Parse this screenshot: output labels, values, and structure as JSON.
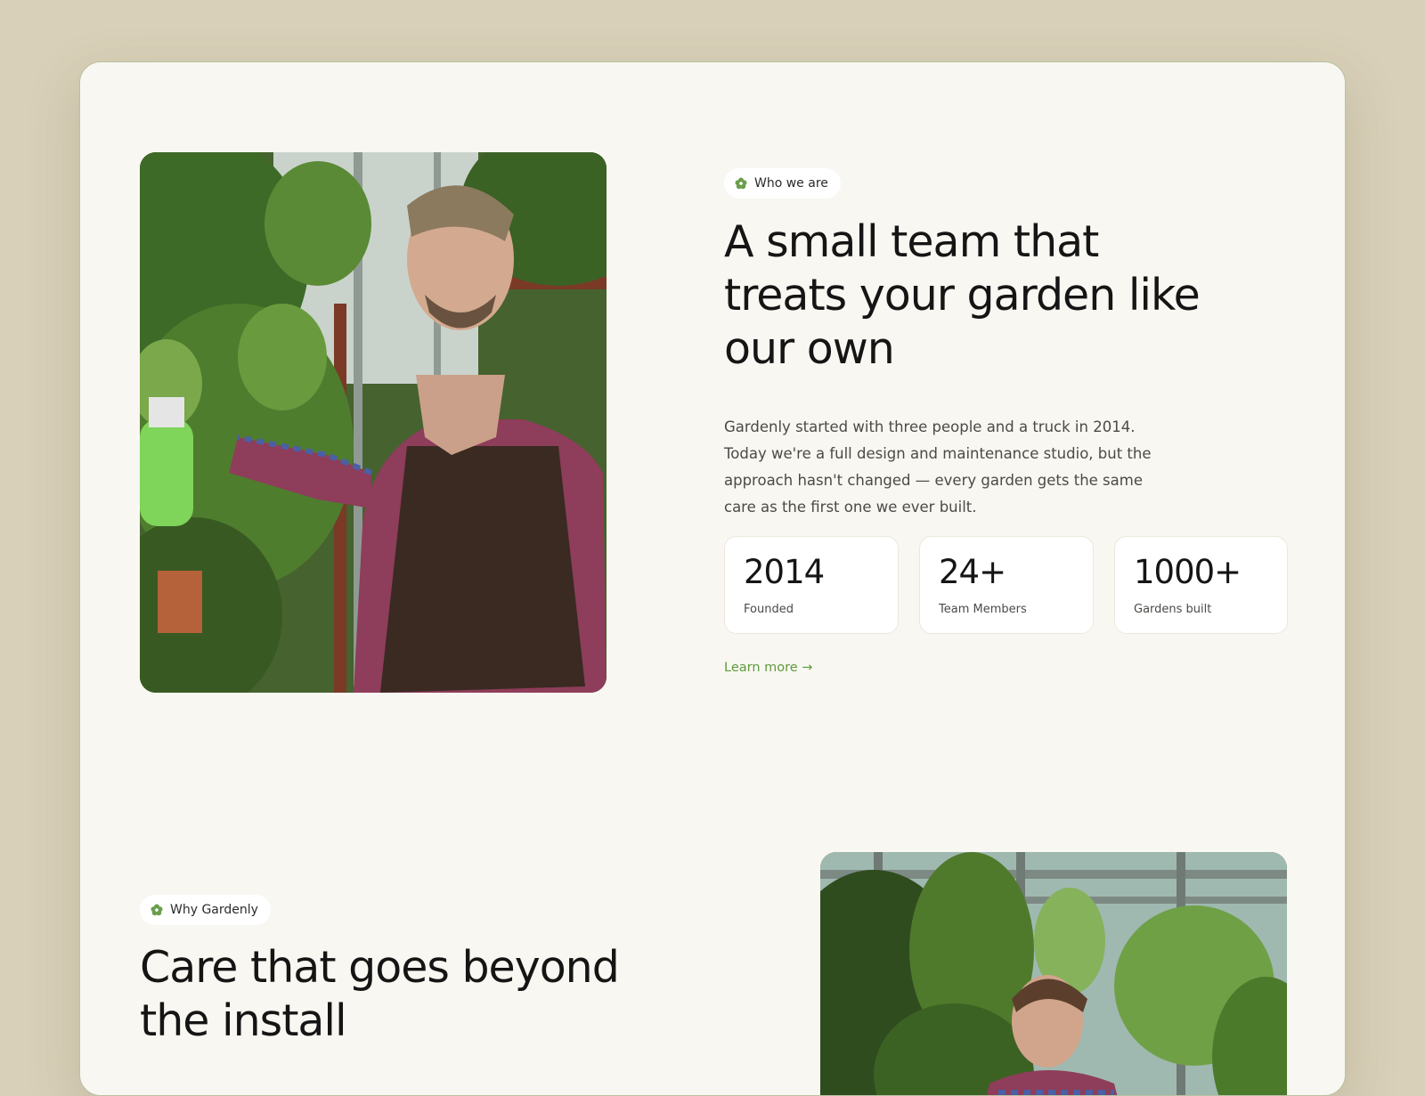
{
  "about": {
    "badge": "Who we are",
    "badge_icon": "flower-icon",
    "headline": "A small team that treats your garden like our own",
    "body": "Gardenly started with three people and a truck in 2014. Today we're a full design and maintenance studio, but the approach hasn't changed — every garden gets the same care as the first one we ever built.",
    "stats": [
      {
        "value": "2014",
        "label": "Founded"
      },
      {
        "value": "24+",
        "label": "Team Members"
      },
      {
        "value": "1000+",
        "label": "Gardens built"
      }
    ],
    "link_label": "Learn more →"
  },
  "why": {
    "badge": "Why Gardenly",
    "badge_icon": "flower-icon",
    "headline": "Care that goes beyond the install"
  },
  "colors": {
    "page_bg": "#d8d0b8",
    "card_bg": "#f9f7f1",
    "accent_green": "#5f9a3f",
    "text_dark": "#151515",
    "text_body": "#4a4a47"
  }
}
